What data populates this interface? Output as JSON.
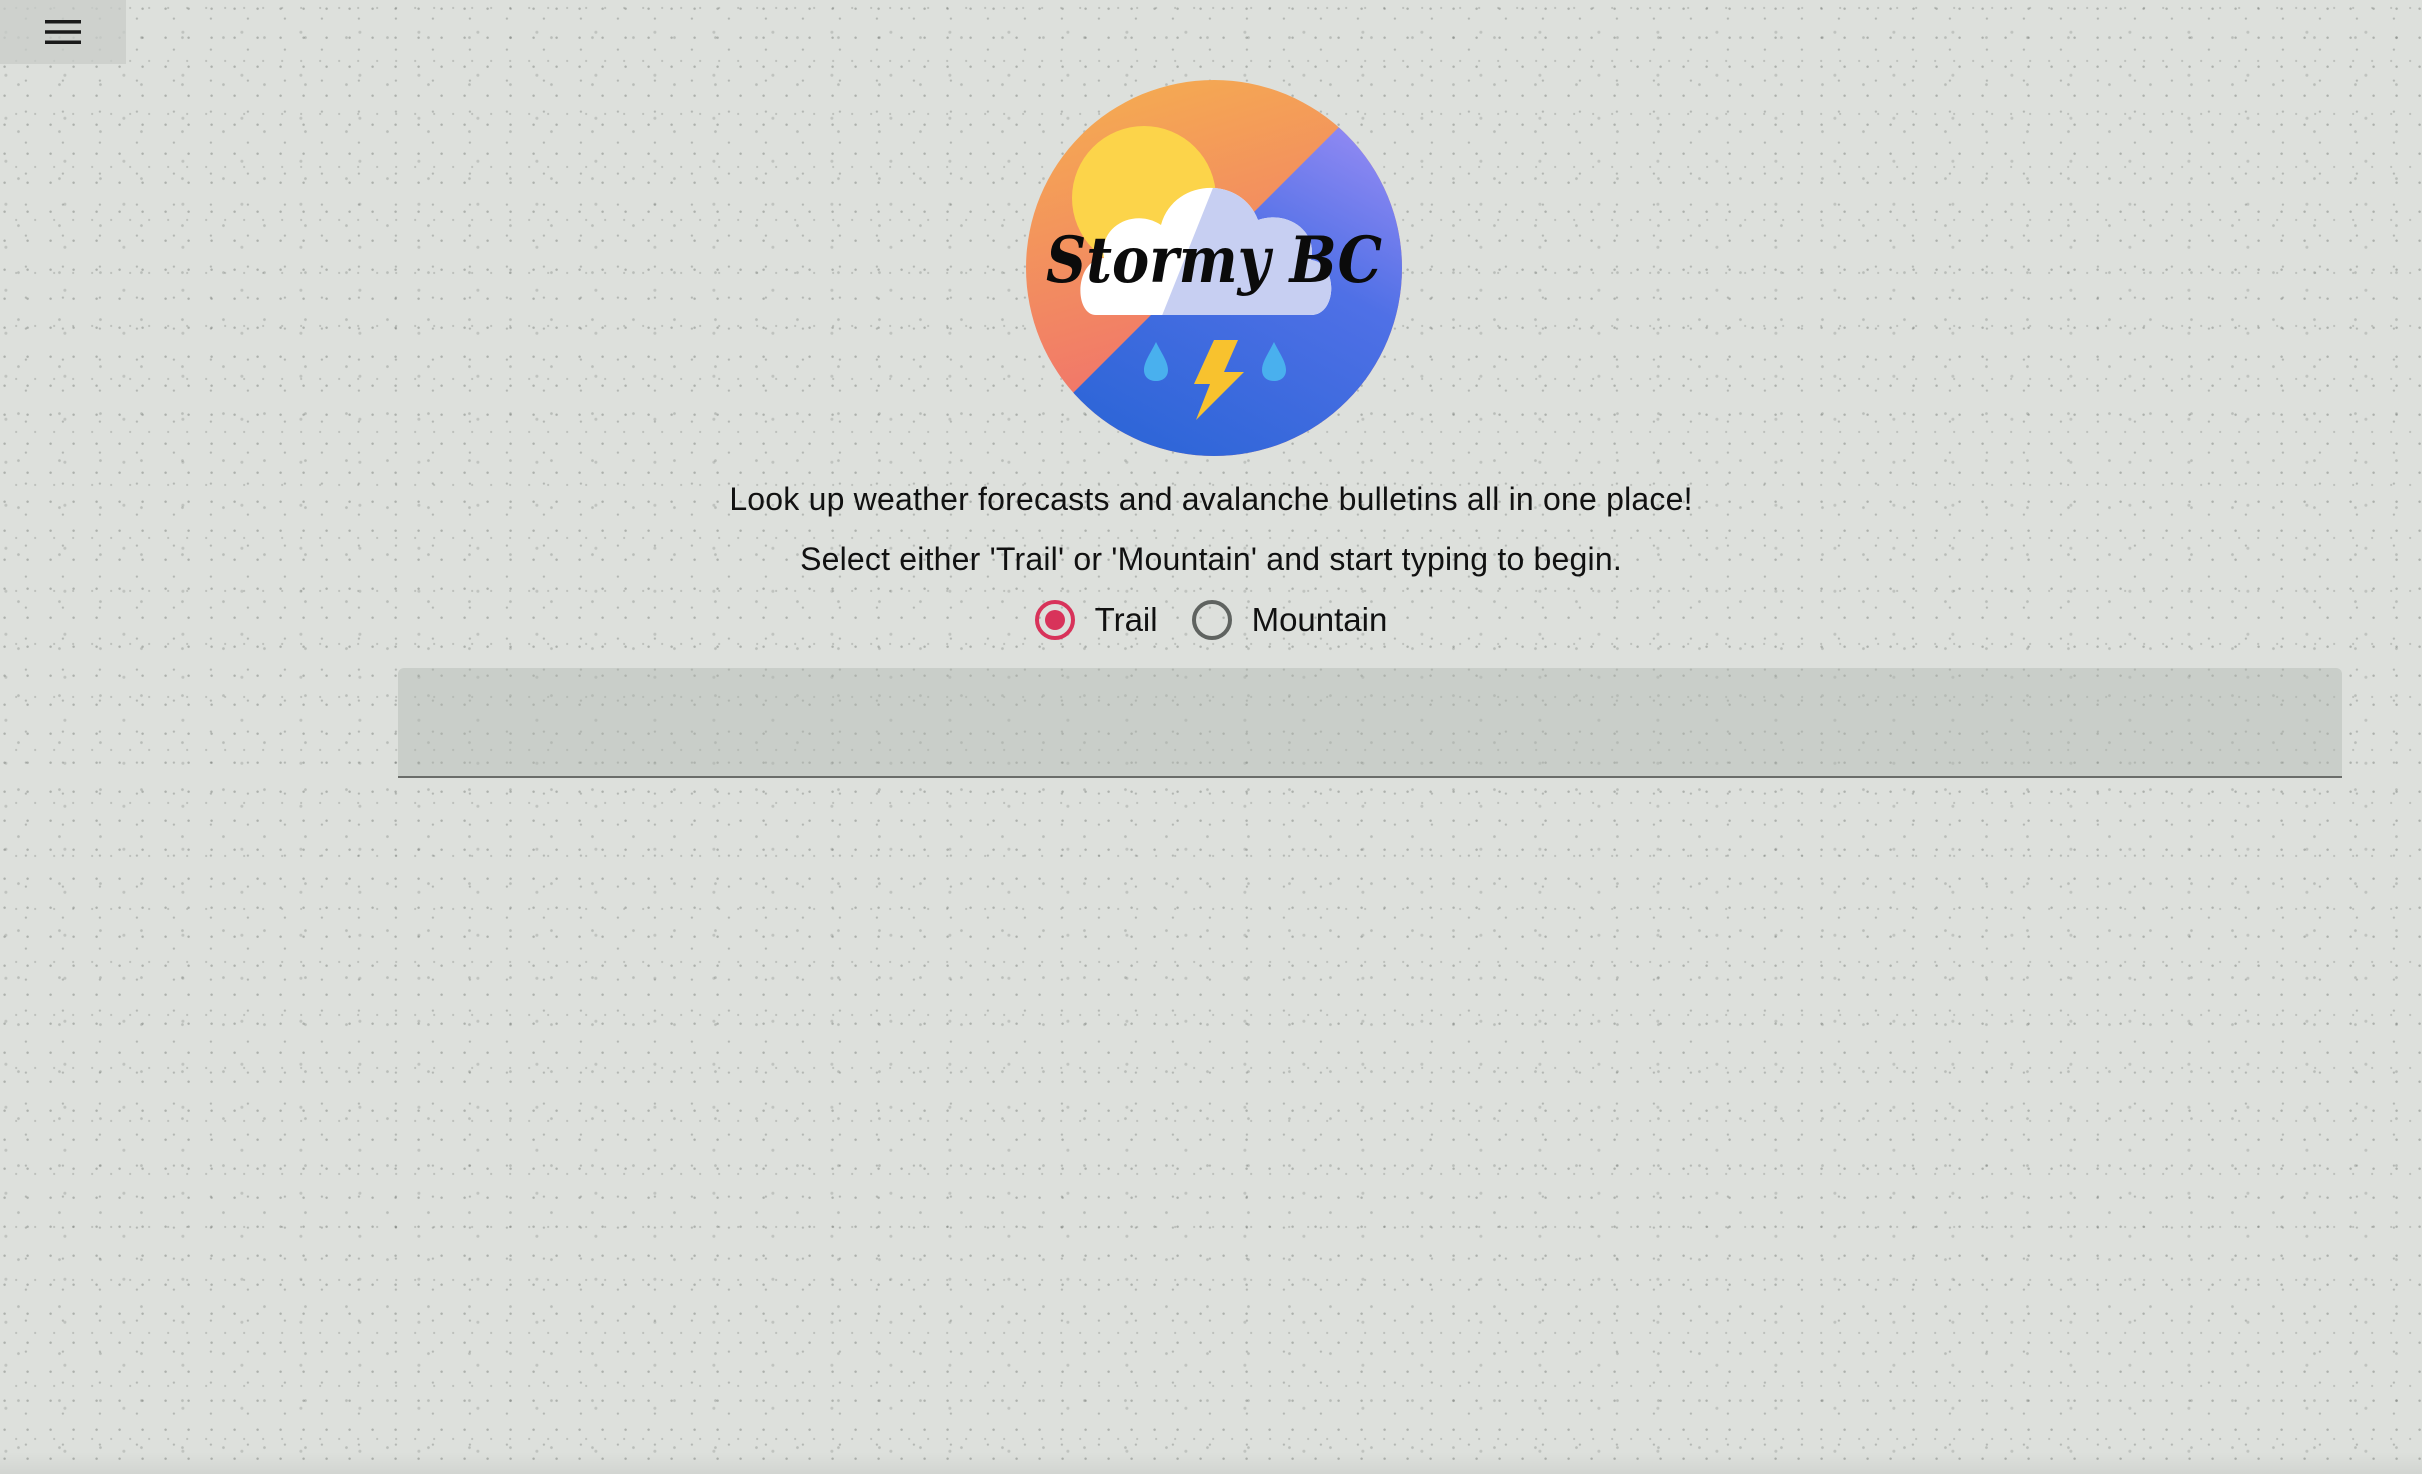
{
  "nav": {
    "menu_icon": "hamburger-menu-icon"
  },
  "logo": {
    "text": "Stormy BC",
    "icon": "storm-cloud-sun-lightning-icon",
    "colors": {
      "sun": "#fcd44a",
      "orange": "#f5a857",
      "purple": "#8f8bf0",
      "blue": "#3b68dd",
      "coral": "#f0706a",
      "bolt": "#f8c22e",
      "rain": "#49b0ee"
    }
  },
  "intro": {
    "line1": "Look up weather forecasts and avalanche bulletins all in one place!",
    "line2": "Select either 'Trail' or 'Mountain' and start typing to begin."
  },
  "search_mode": {
    "selected": "Trail",
    "options": [
      {
        "label": "Trail",
        "checked": true
      },
      {
        "label": "Mountain",
        "checked": false
      }
    ]
  },
  "search": {
    "value": "",
    "placeholder": ""
  },
  "colors": {
    "accent": "#d8335a",
    "background": "#dde0dc"
  }
}
